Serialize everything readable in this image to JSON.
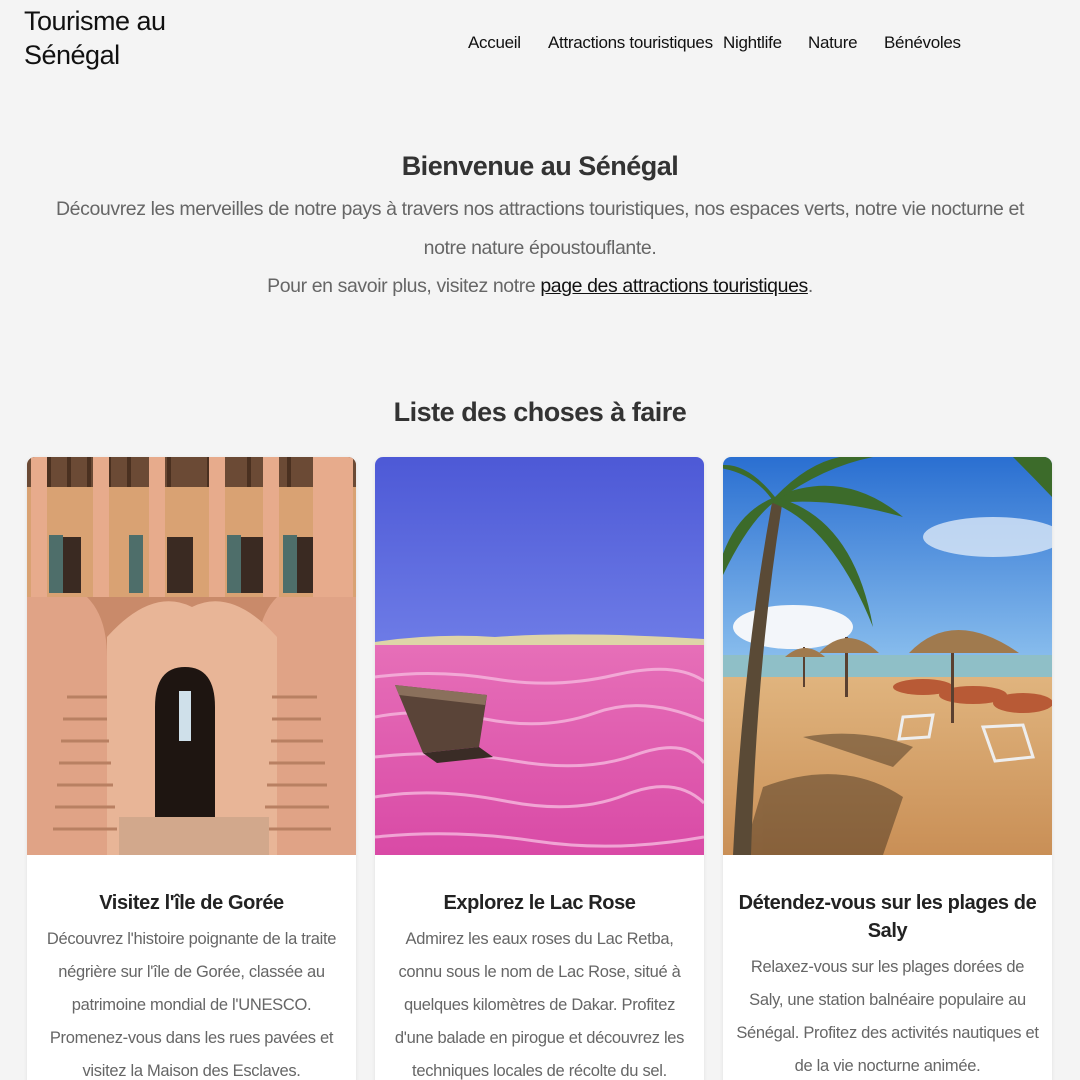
{
  "header": {
    "brand": "Tourisme au Sénégal",
    "nav": [
      "Accueil",
      "Attractions touristiques",
      "Nightlife",
      "Nature",
      "Bénévoles"
    ]
  },
  "welcome": {
    "title": "Bienvenue au Sénégal",
    "intro": "Découvrez les merveilles de notre pays à travers nos attractions touristiques, nos espaces verts, notre vie nocturne et notre nature époustouflante.",
    "more_prefix": "Pour en savoir plus, visitez notre ",
    "more_link": "page des attractions touristiques",
    "more_suffix": "."
  },
  "todo": {
    "title": "Liste des choses à faire",
    "cards": [
      {
        "title": "Visitez l'île de Gorée",
        "text": "Découvrez l'histoire poignante de la traite négrière sur l'île de Gorée, classée au patrimoine mondial de l'UNESCO. Promenez-vous dans les rues pavées et visitez la Maison des Esclaves.",
        "image": "goree-staircase-photo"
      },
      {
        "title": "Explorez le Lac Rose",
        "text": "Admirez les eaux roses du Lac Retba, connu sous le nom de Lac Rose, situé à quelques kilomètres de Dakar. Profitez d'une balade en pirogue et découvrez les techniques locales de récolte du sel.",
        "image": "lac-rose-boat-photo"
      },
      {
        "title": "Détendez-vous sur les plages de Saly",
        "text": "Relaxez-vous sur les plages dorées de Saly, une station balnéaire populaire au Sénégal. Profitez des activités nautiques et de la vie nocturne animée.",
        "image": "saly-beach-photo"
      }
    ]
  }
}
